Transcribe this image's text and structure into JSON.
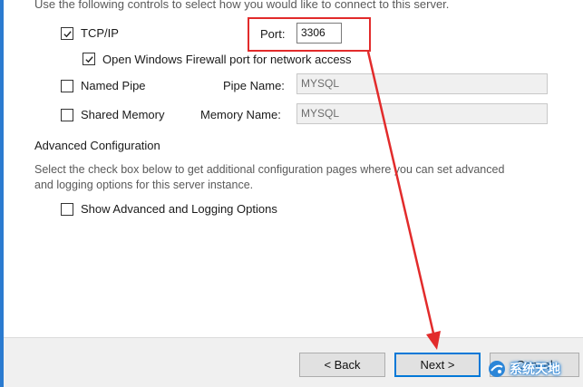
{
  "intro_text": "Use the following controls to select how you would like to connect to this server.",
  "tcpip": {
    "label": "TCP/IP",
    "checked": true
  },
  "port": {
    "label": "Port:",
    "value": "3306"
  },
  "firewall": {
    "label": "Open Windows Firewall port for network access",
    "checked": true
  },
  "named_pipe": {
    "label": "Named Pipe",
    "checked": false,
    "field_label": "Pipe Name:",
    "value": "MYSQL"
  },
  "shared_memory": {
    "label": "Shared Memory",
    "checked": false,
    "field_label": "Memory Name:",
    "value": "MYSQL"
  },
  "advanced": {
    "heading": "Advanced Configuration",
    "description_line1": "Select the check box below to get additional configuration pages where you can set advanced",
    "description_line2": "and logging options for this server instance.",
    "option_label": "Show Advanced and Logging Options",
    "checked": false
  },
  "buttons": {
    "back": "< Back",
    "next": "Next >",
    "cancel": "Cancel"
  },
  "watermark": {
    "text": "系统天地"
  },
  "colors": {
    "annotation": "#e22b2b",
    "focus": "#0078d7",
    "accent": "#2b7bd0"
  }
}
